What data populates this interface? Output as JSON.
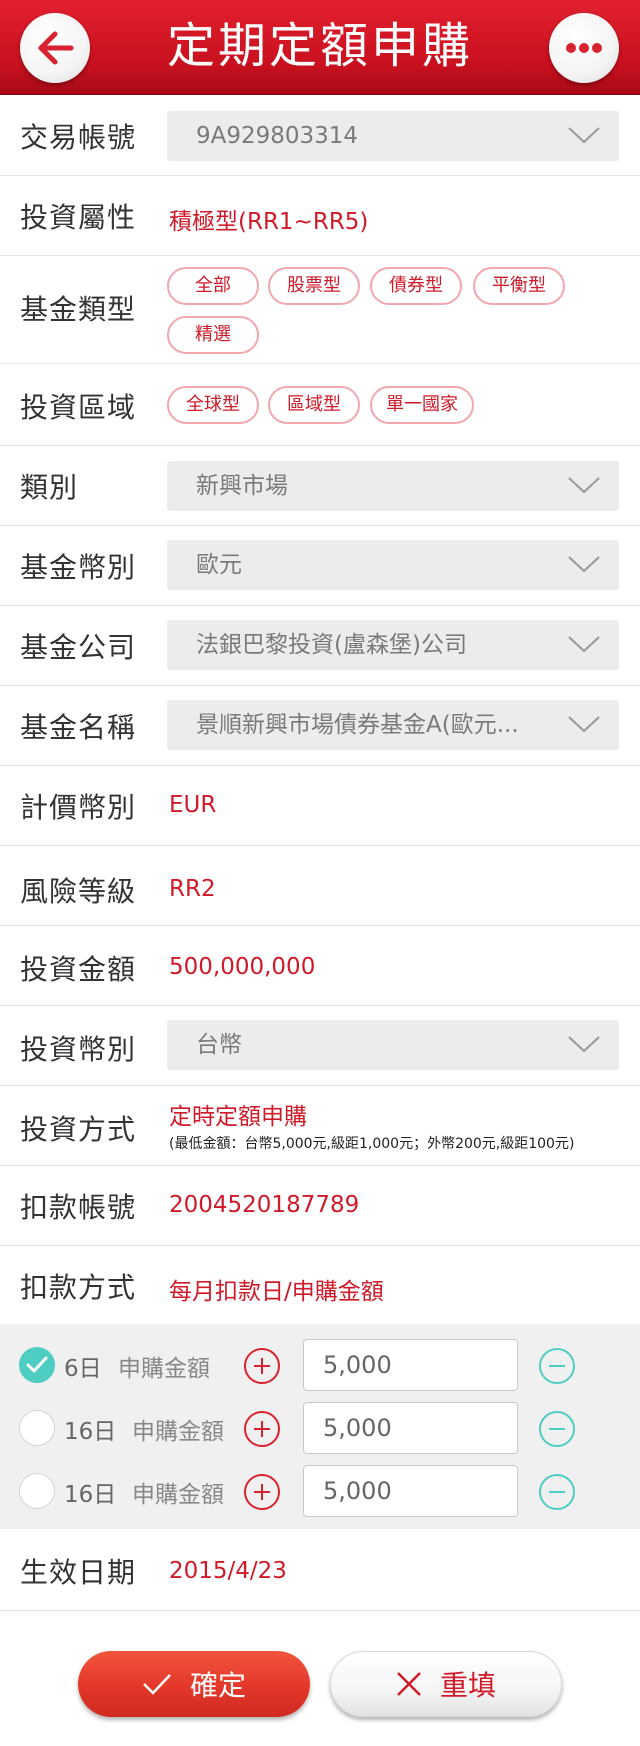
{
  "header": {
    "title": "定期定額申購",
    "back_icon": "arrow-left-icon",
    "more_icon": "more-dots-icon"
  },
  "colors": {
    "brand_red": "#d9222f",
    "value_red": "#cf1a2a",
    "teal": "#4ecdc2"
  },
  "form": {
    "account": {
      "label": "交易帳號",
      "value": "9A929803314"
    },
    "risk_profile": {
      "label": "投資屬性",
      "value": "積極型(RR1~RR5)"
    },
    "fund_type": {
      "label": "基金類型",
      "options": [
        "全部",
        "股票型",
        "債券型",
        "平衡型",
        "精選"
      ]
    },
    "region": {
      "label": "投資區域",
      "options": [
        "全球型",
        "區域型",
        "單一國家"
      ]
    },
    "category": {
      "label": "類別",
      "value": "新興市場"
    },
    "fund_currency": {
      "label": "基金幣別",
      "value": "歐元"
    },
    "fund_company": {
      "label": "基金公司",
      "value": "法銀巴黎投資(盧森堡)公司"
    },
    "fund_name": {
      "label": "基金名稱",
      "value": "景順新興市場債券基金A(歐元..."
    },
    "pricing_currency": {
      "label": "計價幣別",
      "value": "EUR"
    },
    "risk_level": {
      "label": "風險等級",
      "value": "RR2"
    },
    "invest_amount": {
      "label": "投資金額",
      "value": "500,000,000"
    },
    "invest_currency": {
      "label": "投資幣別",
      "value": "台幣"
    },
    "invest_method": {
      "label": "投資方式",
      "value": "定時定額申購",
      "note": "(最低金額：台幣5,000元,級距1,000元；外幣200元,級距100元)"
    },
    "debit_account": {
      "label": "扣款帳號",
      "value": "2004520187789"
    },
    "debit_method": {
      "label": "扣款方式",
      "value": "每月扣款日/申購金額"
    }
  },
  "schedule": [
    {
      "day": "6日",
      "amount_label": "申購金額",
      "amount": "5,000",
      "checked": true
    },
    {
      "day": "16日",
      "amount_label": "申購金額",
      "amount": "5,000",
      "checked": false
    },
    {
      "day": "16日",
      "amount_label": "申購金額",
      "amount": "5,000",
      "checked": false
    }
  ],
  "effective_date": {
    "label": "生效日期",
    "value": "2015/4/23"
  },
  "buttons": {
    "confirm": "確定",
    "reset": "重填"
  }
}
